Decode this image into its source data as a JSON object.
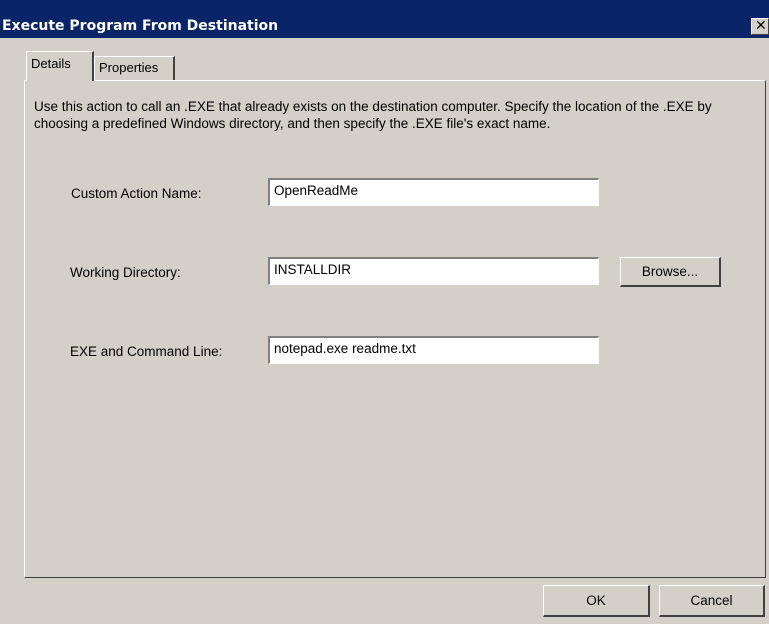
{
  "window": {
    "title": "Execute Program From Destination",
    "close_glyph": "✕"
  },
  "tabs": [
    {
      "label": "Details",
      "selected": true
    },
    {
      "label": "Properties",
      "selected": false
    }
  ],
  "details": {
    "description": "Use this action to call an .EXE that already exists on the destination computer. Specify the location of the .EXE by choosing a predefined Windows directory, and then specify the .EXE file's exact name.",
    "custom_action_name": {
      "label": "Custom Action Name:",
      "value": "OpenReadMe"
    },
    "working_directory": {
      "label": "Working Directory:",
      "value": "INSTALLDIR",
      "browse_label": "Browse..."
    },
    "exe_command_line": {
      "label": "EXE and Command Line:",
      "value": "notepad.exe readme.txt"
    }
  },
  "buttons": {
    "ok_label": "OK",
    "cancel_label": "Cancel"
  },
  "colors": {
    "titlebar": "#0a246a",
    "dialog_face": "#d4d0c8",
    "field_background": "#ffffff"
  }
}
